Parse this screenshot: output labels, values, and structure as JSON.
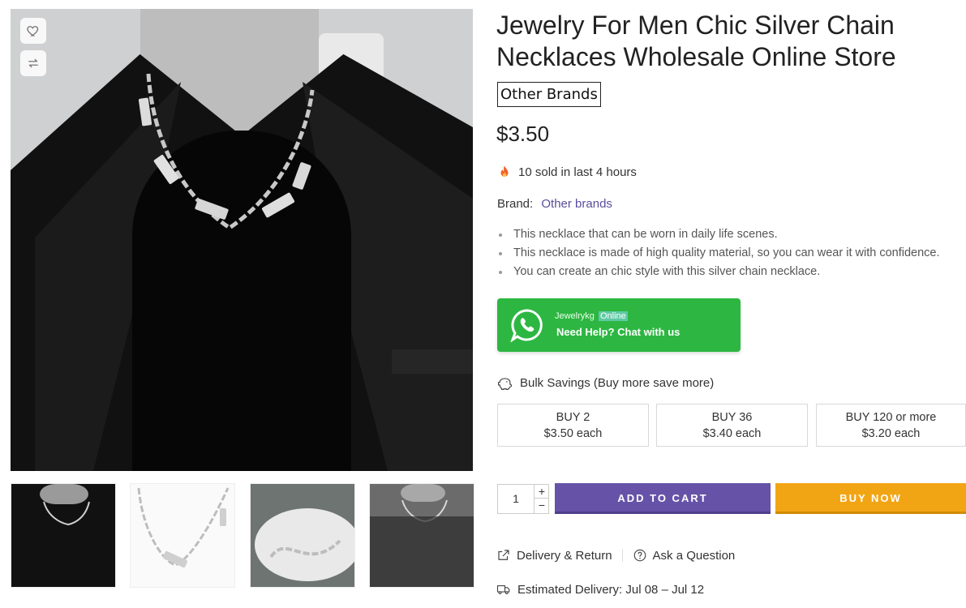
{
  "product": {
    "title": "Jewelry For Men Chic Silver Chain Necklaces Wholesale Online Store",
    "brand_badge": "Other Brands",
    "price": "$3.50",
    "sold_text": "10 sold in last 4 hours",
    "brand_label": "Brand:",
    "brand_link": "Other brands",
    "bullets": [
      "This necklace that can be worn in daily life scenes.",
      "This necklace is made of high quality material, so you can wear it with confidence.",
      "You can create an chic style with this silver chain necklace."
    ]
  },
  "whatsapp": {
    "name": "Jewelrykg",
    "status": "Online",
    "cta": "Need Help? Chat with us",
    "color": "#2db742"
  },
  "bulk": {
    "heading": "Bulk Savings (Buy more save more)",
    "tiers": [
      {
        "qty": "BUY 2",
        "price": "$3.50 each"
      },
      {
        "qty": "BUY 36",
        "price": "$3.40 each"
      },
      {
        "qty": "BUY 120 or more",
        "price": "$3.20 each"
      }
    ]
  },
  "cart": {
    "quantity": "1",
    "plus": "+",
    "minus": "−",
    "add_to_cart": "ADD TO CART",
    "buy_now": "BUY NOW",
    "add_color": "#6653a8",
    "buy_color": "#f2a514"
  },
  "info_links": {
    "delivery_return": "Delivery & Return",
    "ask_question": "Ask a Question",
    "estimated_delivery": "Estimated Delivery: Jul 08 – Jul 12"
  },
  "icons": {
    "wishlist": "heart-icon",
    "compare": "compare-icon"
  }
}
